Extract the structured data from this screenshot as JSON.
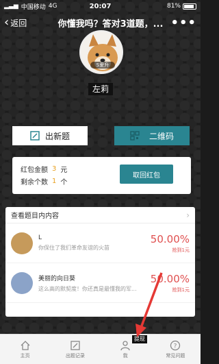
{
  "status_bar": {
    "carrier": "中国移动",
    "network": "4G",
    "time": "20:07",
    "battery": "81%"
  },
  "nav": {
    "back_label": "返回",
    "title": "你懂我吗？答对3道题，...",
    "more": "•••"
  },
  "profile": {
    "avatar_tag": "S爱升",
    "name": "左莉"
  },
  "actions": {
    "new_question": "出新题",
    "qr_code": "二维码"
  },
  "redpack": {
    "amount_label": "红包金额",
    "amount_value": "3",
    "amount_unit": "元",
    "count_label": "剩余个数",
    "count_value": "1",
    "count_unit": "个",
    "withdraw_button": "取回红包"
  },
  "answers": {
    "header": "查看题目内内容",
    "items": [
      {
        "name": "L",
        "message": "你保住了我们革命友谊的火苗",
        "percent": "50.00%",
        "prize": "抢到1元"
      },
      {
        "name": "美丽的向日葵",
        "message": "这么高的默契度！你还真是最懂我的军...",
        "percent": "50.00%",
        "prize": "抢到1元"
      }
    ]
  },
  "tooltip": "提现",
  "tabs": [
    {
      "label": "主页",
      "icon": "home-icon"
    },
    {
      "label": "出题记录",
      "icon": "edit-icon"
    },
    {
      "label": "我",
      "icon": "person-icon"
    },
    {
      "label": "常见问题",
      "icon": "question-icon"
    }
  ],
  "colors": {
    "accent": "#2a8591",
    "highlight": "#e8a020",
    "percent": "#e05050",
    "arrow": "#e53935"
  }
}
